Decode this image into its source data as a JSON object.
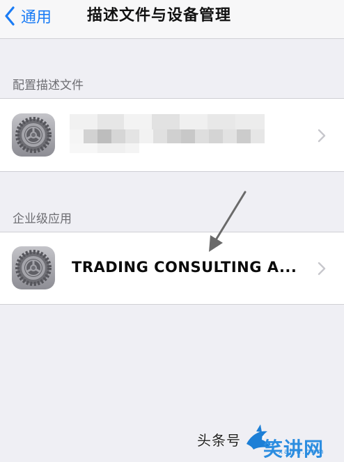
{
  "navbar": {
    "back_label": "通用",
    "title": "描述文件与设备管理"
  },
  "profiles_section": {
    "header": "配置描述文件",
    "items": [
      {
        "name": "",
        "icon": "settings-gear-icon",
        "redacted": true
      }
    ]
  },
  "enterprise_section": {
    "header": "企业级应用",
    "items": [
      {
        "name": "TRADING CONSULTING A...",
        "icon": "settings-gear-icon"
      }
    ]
  },
  "watermark": {
    "text": "头条号",
    "site": "笑讲网",
    "url": "xajjn.com"
  },
  "colors": {
    "accent": "#1a7cf5",
    "background": "#efeff4",
    "header_text": "#6d6d72",
    "chevron": "#c7c7cc"
  }
}
